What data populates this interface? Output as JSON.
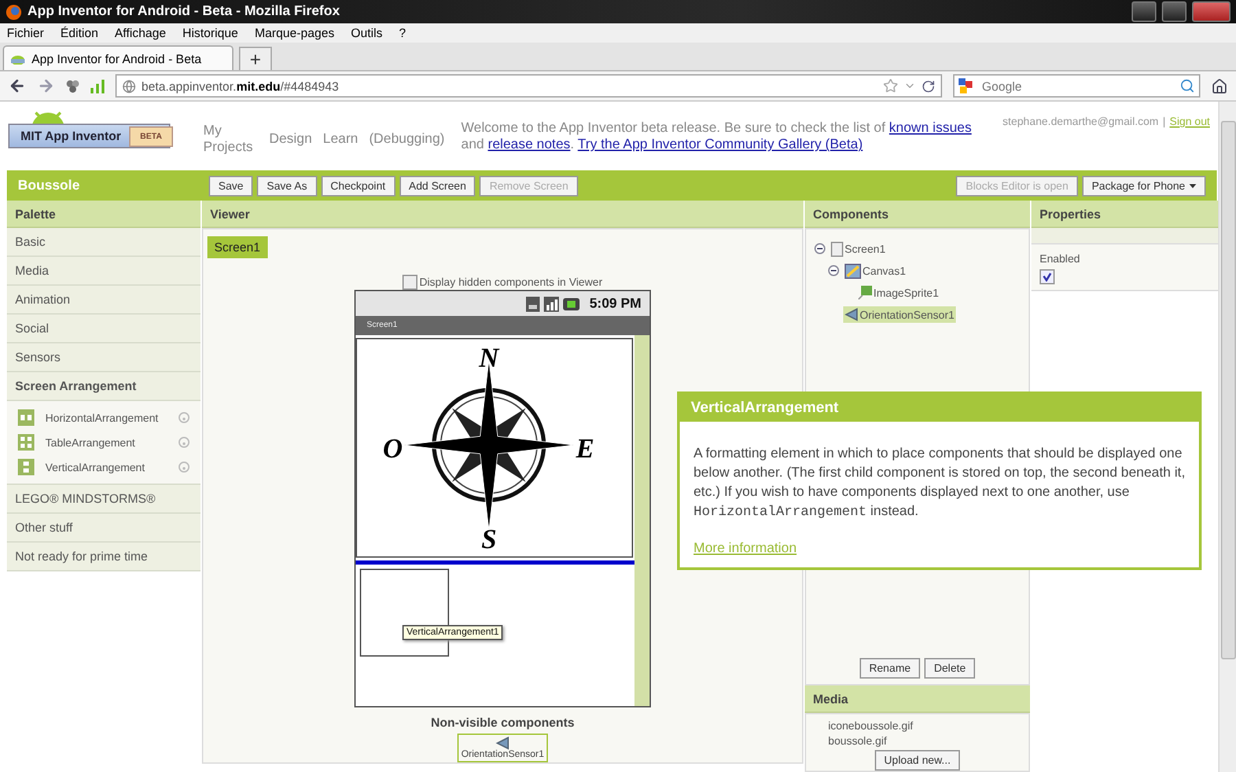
{
  "browser": {
    "window_title": "App Inventor for Android - Beta - Mozilla Firefox",
    "menu": [
      "Fichier",
      "Édition",
      "Affichage",
      "Historique",
      "Marque-pages",
      "Outils",
      "?"
    ],
    "tabs": [
      {
        "label": "App Inventor for Android - Beta",
        "selected": true
      }
    ],
    "new_tab": "+",
    "url": "beta.appinventor.**mit.edu**/#4484943",
    "search": {
      "placeholder": "Google"
    }
  },
  "header": {
    "logo_text": "MIT App Inventor",
    "logo_badge": "BETA",
    "nav": [
      "My Projects",
      "Design",
      "Learn",
      "(Debugging)"
    ],
    "welcome": [
      {
        "text": "Welcome to the App Inventor beta release. Be sure to check the list of ",
        "kind": "text"
      },
      {
        "text": "known issues",
        "kind": "link"
      },
      {
        "text": " and ",
        "kind": "text"
      },
      {
        "text": "release notes",
        "kind": "link"
      },
      {
        "text": ". ",
        "kind": "text"
      },
      {
        "text": "Try the App Inventor Community Gallery (Beta)",
        "kind": "link"
      }
    ],
    "user": "stephane.demarthe@gmail.com",
    "separator": "|",
    "sign_out": "Sign out"
  },
  "project_bar": {
    "name": "Boussole",
    "buttons": [
      {
        "label": "Save",
        "disabled": false
      },
      {
        "label": "Save As",
        "disabled": false
      },
      {
        "label": "Checkpoint",
        "disabled": false
      },
      {
        "label": "Add Screen",
        "disabled": false
      },
      {
        "label": "Remove Screen",
        "disabled": true
      }
    ],
    "right_buttons": [
      {
        "label": "Blocks Editor is open",
        "disabled": true,
        "kind": "plain"
      },
      {
        "label": "Package for Phone",
        "disabled": false,
        "kind": "dropdown"
      }
    ]
  },
  "palette": {
    "title": "Palette",
    "categories": [
      {
        "label": "Basic",
        "expanded": false
      },
      {
        "label": "Media",
        "expanded": false
      },
      {
        "label": "Animation",
        "expanded": false
      },
      {
        "label": "Social",
        "expanded": false
      },
      {
        "label": "Sensors",
        "expanded": false
      },
      {
        "label": "Screen Arrangement",
        "expanded": true,
        "items": [
          {
            "label": "HorizontalArrangement",
            "kind": "horizontal"
          },
          {
            "label": "TableArrangement",
            "kind": "table"
          },
          {
            "label": "VerticalArrangement",
            "kind": "vertical"
          }
        ]
      },
      {
        "label": "LEGO® MINDSTORMS®",
        "expanded": false
      },
      {
        "label": "Other stuff",
        "expanded": false
      },
      {
        "label": "Not ready for prime time",
        "expanded": false
      }
    ]
  },
  "viewer": {
    "title": "Viewer",
    "screen_tabs": [
      {
        "label": "Screen1",
        "selected": true
      }
    ],
    "hidden_toggle": {
      "label": "Display hidden components in Viewer",
      "checked": false
    },
    "phone": {
      "time": "5:09 PM",
      "title": "Screen1",
      "compass": [
        "N",
        "O",
        "E",
        "S"
      ],
      "arrangement_tooltip": "VerticalArrangement1"
    },
    "nonvisible": {
      "title": "Non-visible components",
      "items": [
        "OrientationSensor1"
      ]
    }
  },
  "components": {
    "title": "Components",
    "tree": [
      {
        "label": "Screen1",
        "kind": "screen",
        "expanded": true,
        "selected": false,
        "children": [
          {
            "label": "Canvas1",
            "kind": "canvas",
            "expanded": true,
            "selected": false,
            "children": [
              {
                "label": "ImageSprite1",
                "kind": "sprite",
                "selected": false
              }
            ]
          },
          {
            "label": "OrientationSensor1",
            "kind": "sensor",
            "selected": true
          }
        ]
      }
    ],
    "buttons": [
      "Rename",
      "Delete"
    ]
  },
  "media": {
    "title": "Media",
    "files": [
      "iconeboussole.gif",
      "boussole.gif"
    ],
    "upload": "Upload new..."
  },
  "properties": {
    "title": "Properties",
    "fields": [
      {
        "label": "Enabled",
        "checked": true
      }
    ]
  },
  "popup": {
    "title": "VerticalArrangement",
    "description": [
      {
        "text": "A formatting element in which to place components that should be displayed one below another. (The first child component is stored on top, the second beneath it, etc.) If you wish to have components displayed next to one another, use ",
        "kind": "text"
      },
      {
        "text": "HorizontalArrangement",
        "kind": "code"
      },
      {
        "text": " instead.",
        "kind": "text"
      }
    ],
    "link": "More information"
  }
}
